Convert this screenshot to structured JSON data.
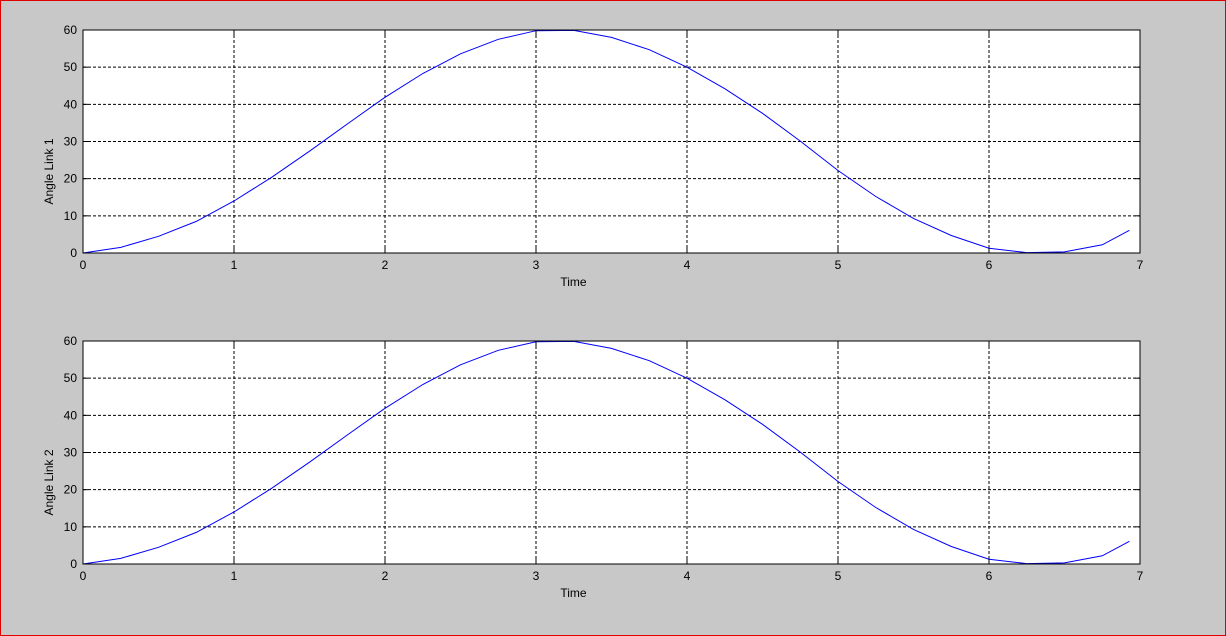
{
  "window": {
    "border_color": "#e00000",
    "background": "#c8c8c8"
  },
  "chart_data": [
    {
      "type": "line",
      "xlabel": "Time",
      "ylabel": "Angle Link 1",
      "xlim": [
        0,
        7
      ],
      "ylim": [
        0,
        60
      ],
      "xticks": [
        "0",
        "1",
        "2",
        "3",
        "4",
        "5",
        "6",
        "7"
      ],
      "yticks": [
        "0",
        "10",
        "20",
        "30",
        "40",
        "50",
        "60"
      ],
      "grid": true,
      "line_color": "#0000ff",
      "series": [
        {
          "x": [
            0,
            0.25,
            0.5,
            0.75,
            1.0,
            1.25,
            1.5,
            1.75,
            2.0,
            2.25,
            2.5,
            2.75,
            3.0,
            3.25,
            3.5,
            3.75,
            4.0,
            4.25,
            4.5,
            4.75,
            5.0,
            5.25,
            5.5,
            5.75,
            6.0,
            6.25,
            6.5,
            6.75,
            6.93
          ],
          "y": [
            0,
            1.5,
            4.5,
            8.5,
            14.0,
            20.4,
            27.4,
            34.7,
            41.9,
            48.3,
            53.6,
            57.5,
            59.8,
            59.9,
            58.0,
            54.7,
            50.0,
            44.2,
            37.6,
            30.1,
            22.2,
            15.2,
            9.3,
            4.7,
            1.3,
            0.1,
            0.3,
            2.2,
            6.1
          ]
        }
      ]
    },
    {
      "type": "line",
      "xlabel": "Time",
      "ylabel": "Angle Link 2",
      "xlim": [
        0,
        7
      ],
      "ylim": [
        0,
        60
      ],
      "xticks": [
        "0",
        "1",
        "2",
        "3",
        "4",
        "5",
        "6",
        "7"
      ],
      "yticks": [
        "0",
        "10",
        "20",
        "30",
        "40",
        "50",
        "60"
      ],
      "grid": true,
      "line_color": "#0000ff",
      "series": [
        {
          "x": [
            0,
            0.25,
            0.5,
            0.75,
            1.0,
            1.25,
            1.5,
            1.75,
            2.0,
            2.25,
            2.5,
            2.75,
            3.0,
            3.25,
            3.5,
            3.75,
            4.0,
            4.25,
            4.5,
            4.75,
            5.0,
            5.25,
            5.5,
            5.75,
            6.0,
            6.25,
            6.5,
            6.75,
            6.93
          ],
          "y": [
            0,
            1.5,
            4.5,
            8.5,
            14.0,
            20.4,
            27.4,
            34.7,
            41.9,
            48.3,
            53.6,
            57.5,
            59.8,
            59.9,
            58.0,
            54.7,
            50.0,
            44.2,
            37.6,
            30.1,
            22.2,
            15.2,
            9.3,
            4.7,
            1.3,
            0.1,
            0.3,
            2.2,
            6.1
          ]
        }
      ]
    }
  ]
}
